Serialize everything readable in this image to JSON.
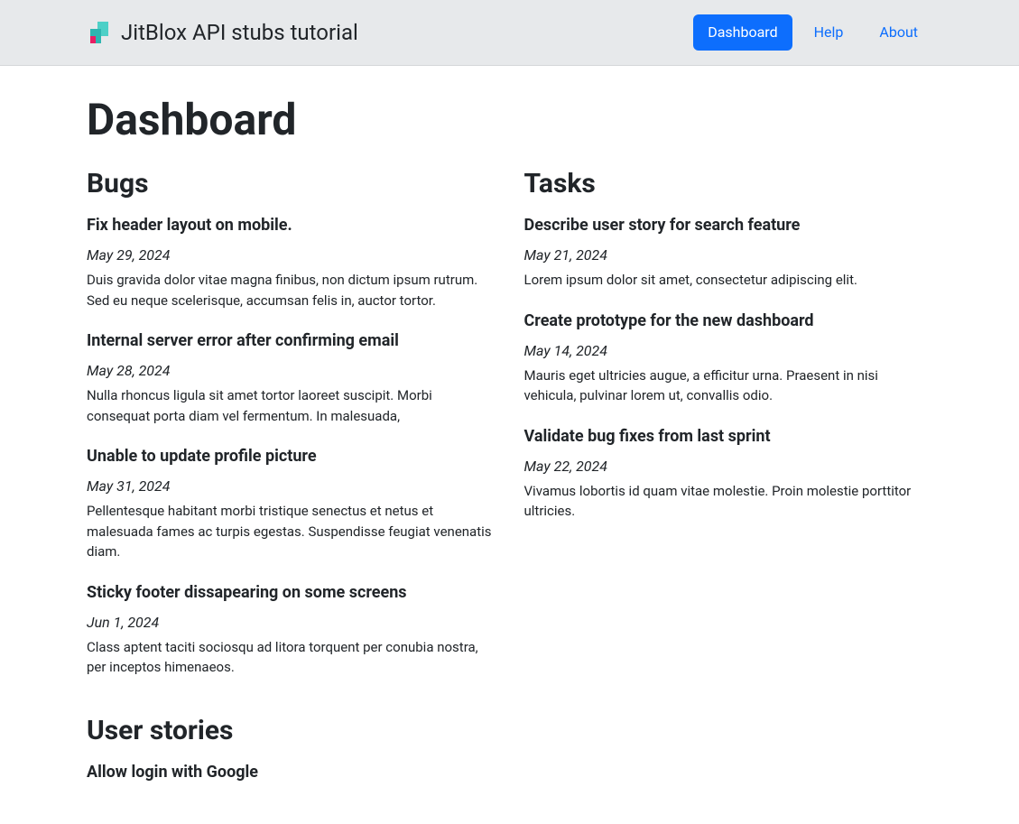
{
  "navbar": {
    "brand": "JitBlox API stubs tutorial",
    "links": [
      {
        "label": "Dashboard",
        "active": true
      },
      {
        "label": "Help",
        "active": false
      },
      {
        "label": "About",
        "active": false
      }
    ]
  },
  "page": {
    "title": "Dashboard"
  },
  "sections": {
    "bugs": {
      "title": "Bugs",
      "items": [
        {
          "title": "Fix header layout on mobile.",
          "date": "May 29, 2024",
          "description": "Duis gravida dolor vitae magna finibus, non dictum ipsum rutrum. Sed eu neque scelerisque, accumsan felis in, auctor tortor."
        },
        {
          "title": "Internal server error after confirming email",
          "date": "May 28, 2024",
          "description": "Nulla rhoncus ligula sit amet tortor laoreet suscipit. Morbi consequat porta diam vel fermentum. In malesuada,"
        },
        {
          "title": "Unable to update profile picture",
          "date": "May 31, 2024",
          "description": "Pellentesque habitant morbi tristique senectus et netus et malesuada fames ac turpis egestas. Suspendisse feugiat venenatis diam."
        },
        {
          "title": "Sticky footer dissapearing on some screens",
          "date": "Jun 1, 2024",
          "description": "Class aptent taciti sociosqu ad litora torquent per conubia nostra, per inceptos himenaeos."
        }
      ]
    },
    "userStories": {
      "title": "User stories",
      "items": [
        {
          "title": "Allow login with Google"
        }
      ]
    },
    "tasks": {
      "title": "Tasks",
      "items": [
        {
          "title": "Describe user story for search feature",
          "date": "May 21, 2024",
          "description": "Lorem ipsum dolor sit amet, consectetur adipiscing elit."
        },
        {
          "title": "Create prototype for the new dashboard",
          "date": "May 14, 2024",
          "description": "Mauris eget ultricies augue, a efficitur urna. Praesent in nisi vehicula, pulvinar lorem ut, convallis odio."
        },
        {
          "title": "Validate bug fixes from last sprint",
          "date": "May 22, 2024",
          "description": "Vivamus lobortis id quam vitae molestie. Proin molestie porttitor ultricies."
        }
      ]
    }
  }
}
